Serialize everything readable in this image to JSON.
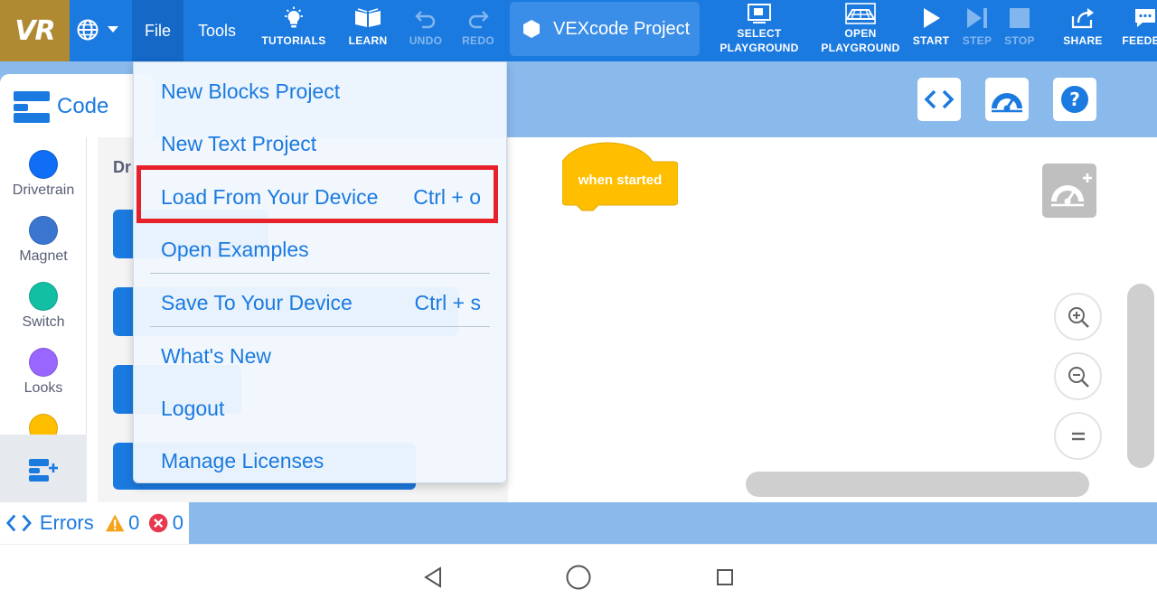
{
  "toolbar": {
    "logo": "VR",
    "menus": {
      "file": "File",
      "tools": "Tools"
    },
    "tutorials": "TUTORIALS",
    "learn": "LEARN",
    "undo": "UNDO",
    "redo": "REDO",
    "project_name": "VEXcode Project",
    "select_playground": "SELECT PLAYGROUND",
    "open_playground": "OPEN PLAYGROUND",
    "start": "START",
    "step": "STEP",
    "stop": "STOP",
    "share": "SHARE",
    "feedback": "FEEDBA",
    "colors": {
      "bar": "#1b7ae0",
      "logo_bg": "#b08a32"
    }
  },
  "code_tab": {
    "label": "Code"
  },
  "categories": [
    {
      "name": "Drivetrain",
      "color": "#0f6ef5"
    },
    {
      "name": "Magnet",
      "color": "#3a76d0"
    },
    {
      "name": "Switch",
      "color": "#12bfa3"
    },
    {
      "name": "Looks",
      "color": "#9966ff"
    }
  ],
  "palette": {
    "title": "Dr"
  },
  "workspace": {
    "hat_block": "when started",
    "hat_color": "#ffbf00"
  },
  "errors": {
    "label": "Errors",
    "warnings": "0",
    "errors": "0"
  },
  "file_menu": {
    "items": [
      {
        "label": "New Blocks Project",
        "shortcut": ""
      },
      {
        "label": "New Text Project",
        "shortcut": ""
      },
      {
        "label": "Load From Your Device",
        "shortcut": "Ctrl + o"
      },
      {
        "label": "Open Examples",
        "shortcut": ""
      },
      {
        "label": "Save To Your Device",
        "shortcut": "Ctrl + s"
      },
      {
        "label": "What's New",
        "shortcut": ""
      },
      {
        "label": "Logout",
        "shortcut": ""
      },
      {
        "label": "Manage Licenses",
        "shortcut": ""
      }
    ],
    "highlighted_item": "Load From Your Device",
    "highlight_color": "#e8202a"
  }
}
